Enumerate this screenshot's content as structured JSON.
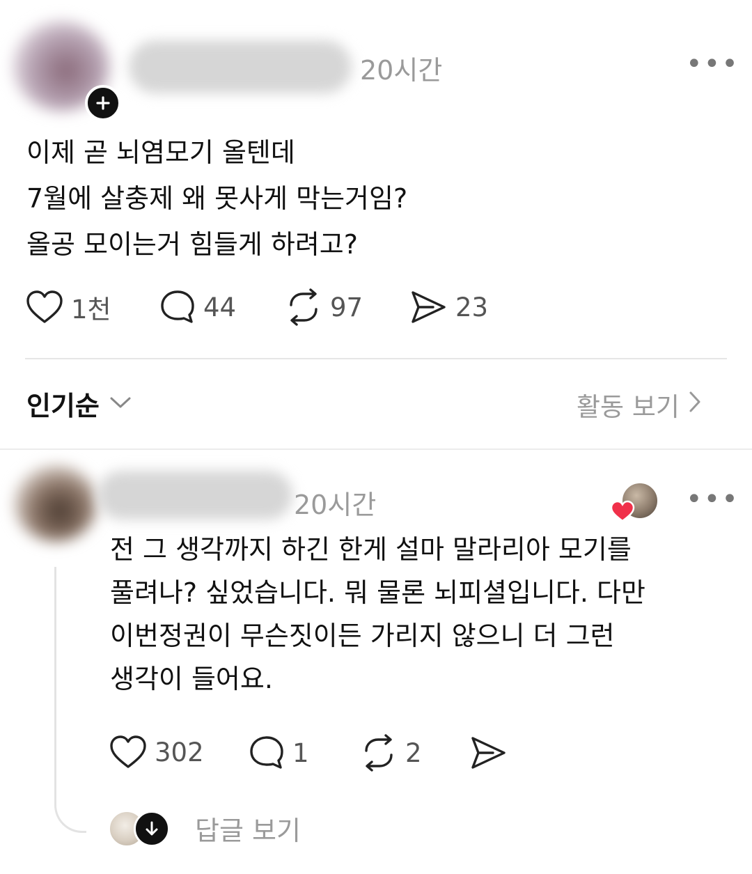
{
  "post": {
    "time": "20시간",
    "more_label": "•••",
    "lines": [
      "이제 곧 뇌염모기 올텐데",
      "7월에 살충제 왜 못사게 막는거임?",
      "올공 모이는거 힘들게 하려고?"
    ],
    "likes": "1천",
    "comments": "44",
    "reposts": "97",
    "shares": "23"
  },
  "sort": {
    "label": "인기순",
    "activity_label": "활동 보기"
  },
  "reply": {
    "time": "20시간",
    "more_label": "•••",
    "lines": [
      "전 그 생각까지 하긴 한게 설마 말라리아 모기를",
      "풀려나? 싶었습니다. 뭐 물론 뇌피셜입니다. 다만",
      "이번정권이 무슨짓이든 가리지 않으니 더 그런",
      "생각이 들어요."
    ],
    "likes": "302",
    "comments": "1",
    "reposts": "2",
    "view_replies_label": "답글 보기"
  },
  "colors": {
    "heart_badge": "#f0304a",
    "text_primary": "#111111",
    "text_secondary": "#9a9a9a"
  }
}
